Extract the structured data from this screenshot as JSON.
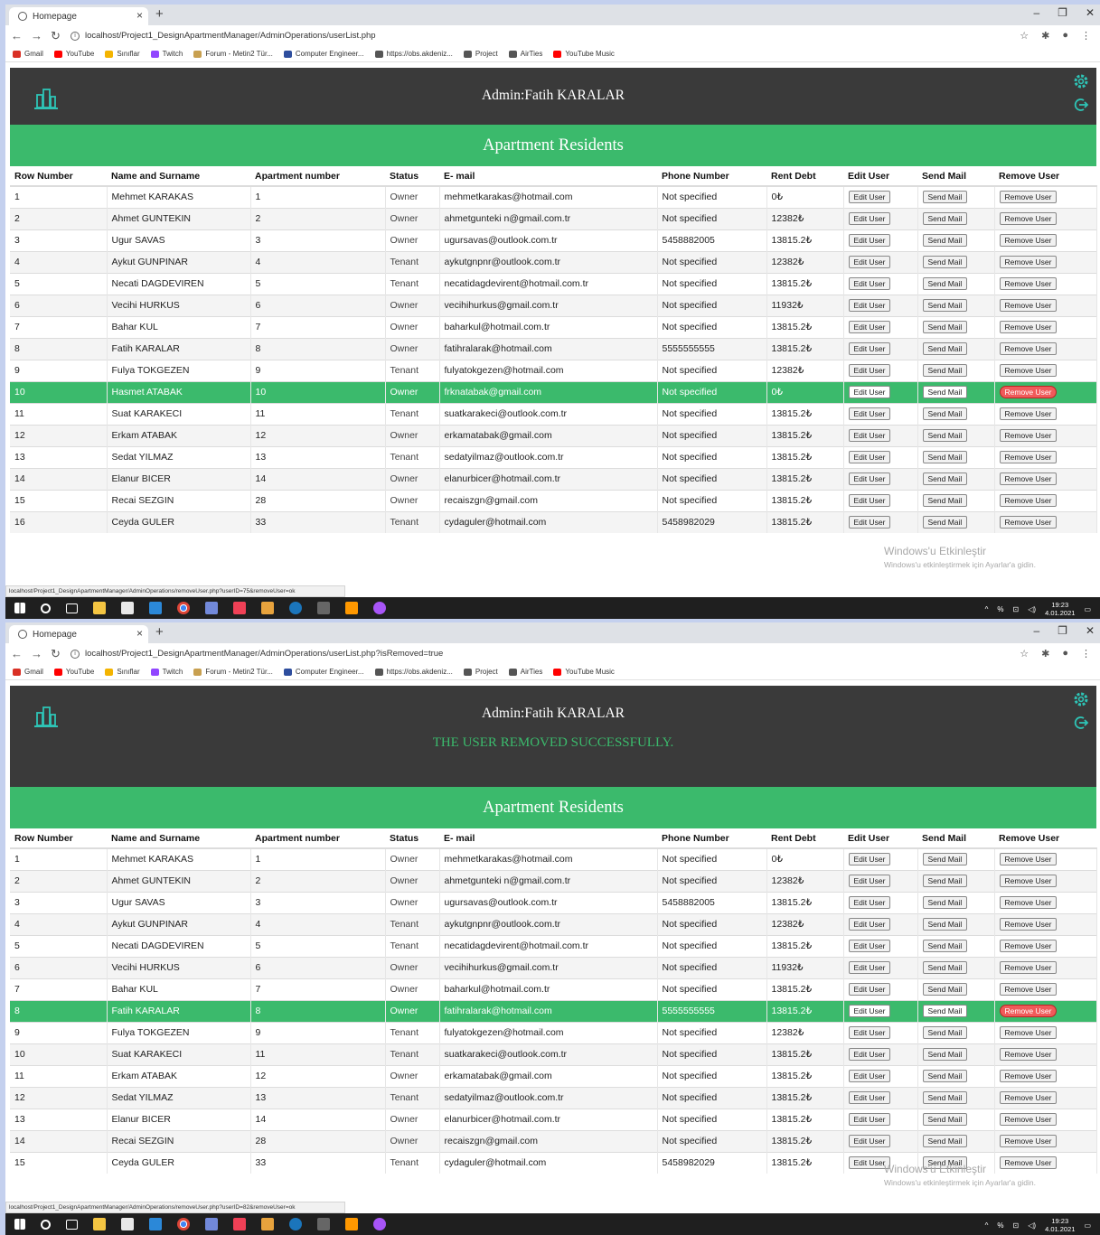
{
  "browser": {
    "tab_title": "Homepage",
    "close_tab": "×",
    "new_tab": "+",
    "window_controls": [
      "–",
      "❐",
      "✕"
    ],
    "bookmarks": [
      {
        "label": "Gmail",
        "color": "#d93025"
      },
      {
        "label": "YouTube",
        "color": "#ff0000"
      },
      {
        "label": "Sınıflar",
        "color": "#f4b400"
      },
      {
        "label": "Twitch",
        "color": "#9146ff"
      },
      {
        "label": "Forum - Metin2 Tür...",
        "color": "#c8a050"
      },
      {
        "label": "Computer Engineer...",
        "color": "#2e4e9e"
      },
      {
        "label": "https://obs.akdeniz...",
        "color": "#555555"
      },
      {
        "label": "Project",
        "color": "#555555"
      },
      {
        "label": "AirTies",
        "color": "#555555"
      },
      {
        "label": "YouTube Music",
        "color": "#ff0000"
      }
    ]
  },
  "header": {
    "admin": "Admin:Fatih KARALAR",
    "page_title": "Apartment Residents",
    "success_message": "THE USER REMOVED SUCCESSFULLY."
  },
  "columns": [
    "Row Number",
    "Name and Surname",
    "Apartment number",
    "Status",
    "E- mail",
    "Phone Number",
    "Rent Debt",
    "Edit User",
    "Send Mail",
    "Remove User"
  ],
  "actions": {
    "edit": "Edit User",
    "mail": "Send Mail",
    "remove": "Remove User"
  },
  "watermark": {
    "line1": "Windows'u Etkinleştir",
    "line2": "Windows'u etkinleştirmek için Ayarlar'a gidin."
  },
  "clock": {
    "time": "19:23",
    "date": "4.01.2021"
  },
  "screens": [
    {
      "url": "localhost/Project1_DesignApartmentManager/AdminOperations/userList.php",
      "status_url": "localhost/Project1_DesignApartmentManager/AdminOperations/removeUser.php?userID=75&removeUser=ok",
      "rows": [
        [
          "1",
          "Mehmet KARAKAS",
          "1",
          "Owner",
          "mehmetkarakas@hotmail.com",
          "Not specified",
          "0₺"
        ],
        [
          "2",
          "Ahmet GUNTEKIN",
          "2",
          "Owner",
          "ahmetgunteki n@gmail.com.tr",
          "Not specified",
          "12382₺"
        ],
        [
          "3",
          "Ugur SAVAS",
          "3",
          "Owner",
          "ugursavas@outlook.com.tr",
          "5458882005",
          "13815.2₺"
        ],
        [
          "4",
          "Aykut GUNPINAR",
          "4",
          "Tenant",
          "aykutgnpnr@outlook.com.tr",
          "Not specified",
          "12382₺"
        ],
        [
          "5",
          "Necati DAGDEVIREN",
          "5",
          "Tenant",
          "necatidagdevirent@hotmail.com.tr",
          "Not specified",
          "13815.2₺"
        ],
        [
          "6",
          "Vecihi HURKUS",
          "6",
          "Owner",
          "vecihihurkus@gmail.com.tr",
          "Not specified",
          "11932₺"
        ],
        [
          "7",
          "Bahar KUL",
          "7",
          "Owner",
          "baharkul@hotmail.com.tr",
          "Not specified",
          "13815.2₺"
        ],
        [
          "8",
          "Fatih KARALAR",
          "8",
          "Owner",
          "fatihralarak@hotmail.com",
          "5555555555",
          "13815.2₺"
        ],
        [
          "9",
          "Fulya TOKGEZEN",
          "9",
          "Tenant",
          "fulyatokgezen@hotmail.com",
          "Not specified",
          "12382₺"
        ],
        [
          "10",
          "Hasmet ATABAK",
          "10",
          "Owner",
          "frknatabak@gmail.com",
          "Not specified",
          "0₺"
        ],
        [
          "11",
          "Suat KARAKECI",
          "11",
          "Tenant",
          "suatkarakeci@outlook.com.tr",
          "Not specified",
          "13815.2₺"
        ],
        [
          "12",
          "Erkam ATABAK",
          "12",
          "Owner",
          "erkamatabak@gmail.com",
          "Not specified",
          "13815.2₺"
        ],
        [
          "13",
          "Sedat YILMAZ",
          "13",
          "Tenant",
          "sedatyilmaz@outlook.com.tr",
          "Not specified",
          "13815.2₺"
        ],
        [
          "14",
          "Elanur BICER",
          "14",
          "Owner",
          "elanurbicer@hotmail.com.tr",
          "Not specified",
          "13815.2₺"
        ],
        [
          "15",
          "Recai SEZGIN",
          "28",
          "Owner",
          "recaiszgn@gmail.com",
          "Not specified",
          "13815.2₺"
        ],
        [
          "16",
          "Ceyda GULER",
          "33",
          "Tenant",
          "cydaguler@hotmail.com",
          "5458982029",
          "13815.2₺"
        ]
      ],
      "highlight": 9
    },
    {
      "url": "localhost/Project1_DesignApartmentManager/AdminOperations/userList.php?isRemoved=true",
      "status_url": "localhost/Project1_DesignApartmentManager/AdminOperations/removeUser.php?userID=82&removeUser=ok",
      "rows": [
        [
          "1",
          "Mehmet KARAKAS",
          "1",
          "Owner",
          "mehmetkarakas@hotmail.com",
          "Not specified",
          "0₺"
        ],
        [
          "2",
          "Ahmet GUNTEKIN",
          "2",
          "Owner",
          "ahmetgunteki n@gmail.com.tr",
          "Not specified",
          "12382₺"
        ],
        [
          "3",
          "Ugur SAVAS",
          "3",
          "Owner",
          "ugursavas@outlook.com.tr",
          "5458882005",
          "13815.2₺"
        ],
        [
          "4",
          "Aykut GUNPINAR",
          "4",
          "Tenant",
          "aykutgnpnr@outlook.com.tr",
          "Not specified",
          "12382₺"
        ],
        [
          "5",
          "Necati DAGDEVIREN",
          "5",
          "Tenant",
          "necatidagdevirent@hotmail.com.tr",
          "Not specified",
          "13815.2₺"
        ],
        [
          "6",
          "Vecihi HURKUS",
          "6",
          "Owner",
          "vecihihurkus@gmail.com.tr",
          "Not specified",
          "11932₺"
        ],
        [
          "7",
          "Bahar KUL",
          "7",
          "Owner",
          "baharkul@hotmail.com.tr",
          "Not specified",
          "13815.2₺"
        ],
        [
          "8",
          "Fatih KARALAR",
          "8",
          "Owner",
          "fatihralarak@hotmail.com",
          "5555555555",
          "13815.2₺"
        ],
        [
          "9",
          "Fulya TOKGEZEN",
          "9",
          "Tenant",
          "fulyatokgezen@hotmail.com",
          "Not specified",
          "12382₺"
        ],
        [
          "10",
          "Suat KARAKECI",
          "11",
          "Tenant",
          "suatkarakeci@outlook.com.tr",
          "Not specified",
          "13815.2₺"
        ],
        [
          "11",
          "Erkam ATABAK",
          "12",
          "Owner",
          "erkamatabak@gmail.com",
          "Not specified",
          "13815.2₺"
        ],
        [
          "12",
          "Sedat YILMAZ",
          "13",
          "Tenant",
          "sedatyilmaz@outlook.com.tr",
          "Not specified",
          "13815.2₺"
        ],
        [
          "13",
          "Elanur BICER",
          "14",
          "Owner",
          "elanurbicer@hotmail.com.tr",
          "Not specified",
          "13815.2₺"
        ],
        [
          "14",
          "Recai SEZGIN",
          "28",
          "Owner",
          "recaiszgn@gmail.com",
          "Not specified",
          "13815.2₺"
        ],
        [
          "15",
          "Ceyda GULER",
          "33",
          "Tenant",
          "cydaguler@hotmail.com",
          "5458982029",
          "13815.2₺"
        ]
      ],
      "highlight": 7
    }
  ]
}
